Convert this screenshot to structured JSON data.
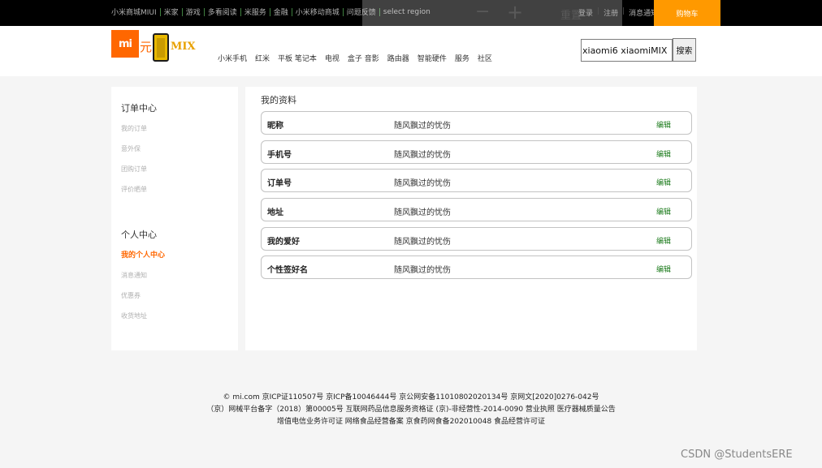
{
  "topbar": {
    "links": [
      "小米商城MIUI",
      "米家",
      "游戏",
      "多看阅读",
      "米服务",
      "金融",
      "小米移动商城",
      "问题反馈",
      "select region"
    ],
    "user_links": [
      "登录",
      "注册",
      "消息通知"
    ],
    "cart_label": "购物车",
    "overlay": {
      "minus": "−",
      "plus": "+",
      "reset": "重置"
    }
  },
  "header": {
    "logo_mi": "mi",
    "logo_text": "元",
    "logo_mix": "MIX",
    "nav": [
      "小米手机",
      "红米",
      "平板 笔记本",
      "电视",
      "盒子 音影",
      "路由器",
      "智能硬件",
      "服务",
      "社区"
    ],
    "search_value": "xiaomi6 xiaomiMIX",
    "search_button": "搜索"
  },
  "sidebar": {
    "order_title": "订单中心",
    "order_links": [
      "我的订单",
      "意外保",
      "团购订单",
      "评价晒单"
    ],
    "personal_title": "个人中心",
    "personal_links": [
      "我的个人中心",
      "消息通知",
      "优惠券",
      "收货地址"
    ]
  },
  "profile": {
    "title": "我的资料",
    "rows": [
      {
        "label": "昵称",
        "value": "随风飘过的忧伤",
        "edit": "编辑"
      },
      {
        "label": "手机号",
        "value": "随风飘过的忧伤",
        "edit": "编辑"
      },
      {
        "label": "订单号",
        "value": "随风飘过的忧伤",
        "edit": "编辑"
      },
      {
        "label": "地址",
        "value": "随风飘过的忧伤",
        "edit": "编辑"
      },
      {
        "label": "我的爱好",
        "value": "随风飘过的忧伤",
        "edit": "编辑"
      },
      {
        "label": "个性签好名",
        "value": "随风飘过的忧伤",
        "edit": "编辑"
      }
    ]
  },
  "footer": {
    "lines": [
      "© mi.com 京ICP证110507号 京ICP备10046444号 京公网安备11010802020134号 京网文[2020]0276-042号",
      "（京）网械平台备字（2018）第00005号 互联网药品信息服务资格证 (京)-非经营性-2014-0090 营业执照 医疗器械质量公告",
      "增值电信业务许可证 网络食品经营备案 京食药网食备202010048 食品经营许可证"
    ]
  },
  "watermark": "CSDN @StudentsERE"
}
